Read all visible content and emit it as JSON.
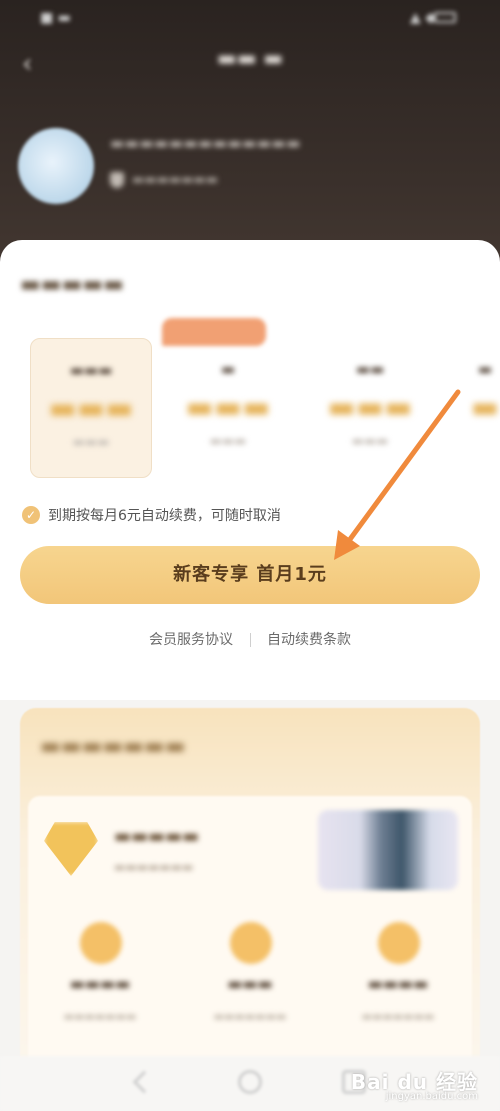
{
  "colors": {
    "header_bg": "#2a2320",
    "cta_bg": "#f2c679",
    "accent_gold": "#e6b45b",
    "check_color": "#f0c277",
    "arrow_color": "#f08a3c"
  },
  "icons": {
    "back": "back-arrow-icon",
    "check": "check-circle-icon",
    "gem": "diamond-icon"
  },
  "renew": {
    "notice": "到期按每月6元自动续费，可随时取消"
  },
  "cta": {
    "label": "新客专享 首月1元"
  },
  "links": {
    "service_agreement": "会员服务协议",
    "auto_renew_terms": "自动续费条款"
  },
  "watermark": {
    "brand": "Bai du 经验",
    "url": "jingyan.baidu.com"
  }
}
